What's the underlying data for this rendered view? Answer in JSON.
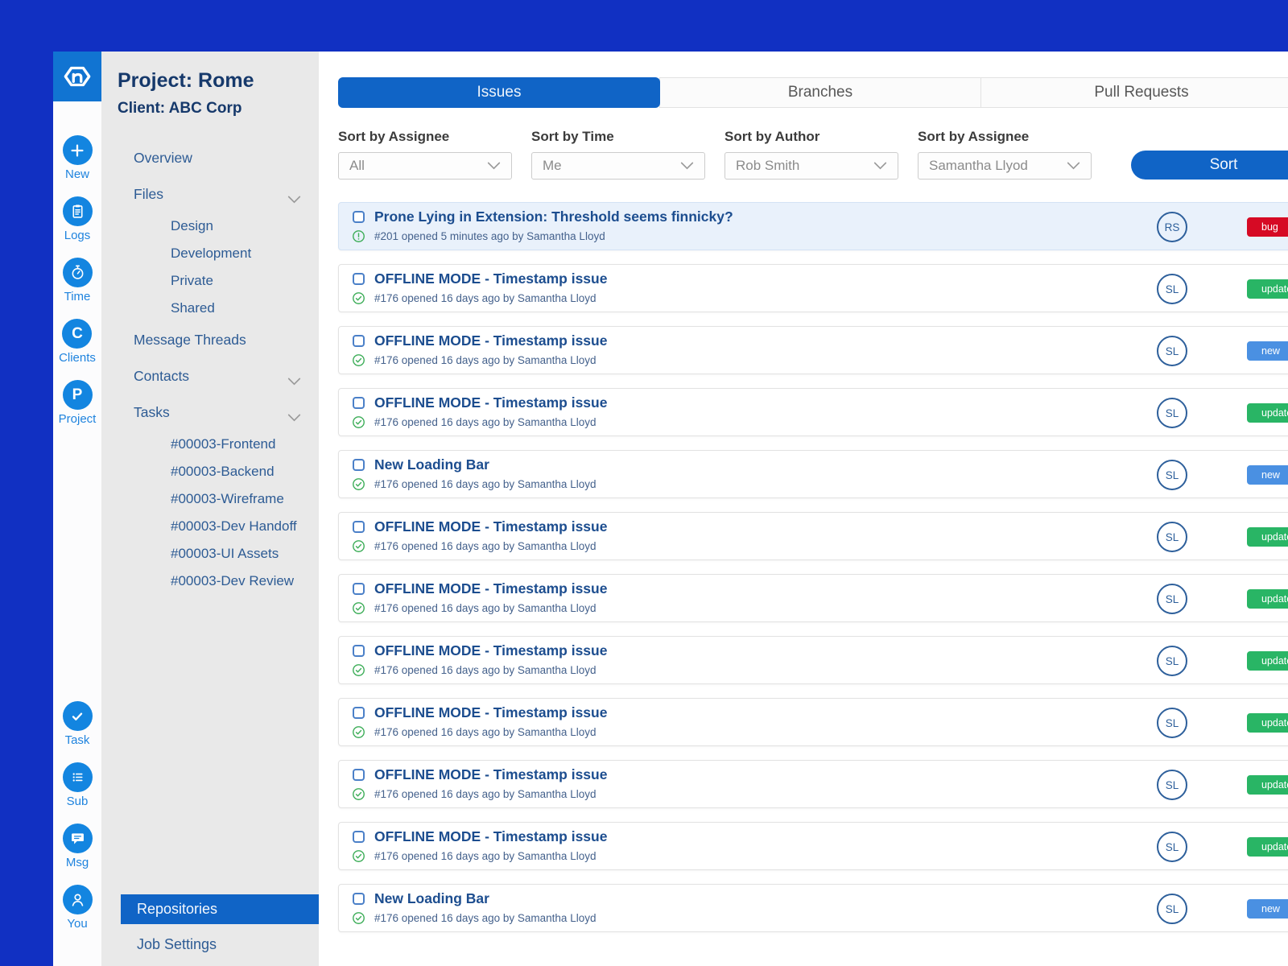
{
  "colors": {
    "frame_blue": "#1130c2",
    "logo_blue": "#1174d2",
    "icon_blue": "#1385e0",
    "primary_blue": "#1064c6",
    "sidebar_bg": "#e9e9e9",
    "badge_red": "#d60a24",
    "badge_green": "#29b565",
    "badge_blue": "#4a90e2",
    "status_green": "#3fae5a"
  },
  "rail": {
    "groups": [
      [
        {
          "icon": "plus-icon",
          "label": "New"
        },
        {
          "icon": "clipboard-icon",
          "label": "Logs"
        },
        {
          "icon": "stopwatch-icon",
          "label": "Time"
        },
        {
          "icon": "letter-c-icon",
          "glyph": "C",
          "label": "Clients"
        },
        {
          "icon": "letter-p-icon",
          "glyph": "P",
          "label": "Project"
        }
      ],
      [
        {
          "icon": "check-icon",
          "label": "Task"
        },
        {
          "icon": "list-icon",
          "label": "Sub"
        },
        {
          "icon": "chat-icon",
          "label": "Msg"
        },
        {
          "icon": "person-icon",
          "label": "You"
        }
      ]
    ]
  },
  "sidebar": {
    "project_title": "Project: Rome",
    "client": "Client: ABC Corp",
    "items": [
      {
        "label": "Overview",
        "level": 0
      },
      {
        "label": "Files",
        "level": 0,
        "chevron": true
      },
      {
        "label": "Design",
        "level": 1
      },
      {
        "label": "Development",
        "level": 1
      },
      {
        "label": "Private",
        "level": 1
      },
      {
        "label": "Shared",
        "level": 1
      },
      {
        "label": "Message Threads",
        "level": 0
      },
      {
        "label": "Contacts",
        "level": 0,
        "chevron": true
      },
      {
        "label": "Tasks",
        "level": 0,
        "chevron": true
      },
      {
        "label": "#00003-Frontend",
        "level": 1
      },
      {
        "label": "#00003-Backend",
        "level": 1
      },
      {
        "label": "#00003-Wireframe",
        "level": 1
      },
      {
        "label": "#00003-Dev Handoff",
        "level": 1
      },
      {
        "label": "#00003-UI Assets",
        "level": 1
      },
      {
        "label": "#00003-Dev Review",
        "level": 1
      }
    ],
    "bottom_items": [
      {
        "label": "Repositories",
        "active": true
      },
      {
        "label": "Job Settings",
        "active": false
      }
    ]
  },
  "tabs": [
    {
      "label": "Issues",
      "active": true
    },
    {
      "label": "Branches",
      "active": false
    },
    {
      "label": "Pull Requests",
      "active": false
    }
  ],
  "filters": [
    {
      "label": "Sort by Assignee",
      "value": "All"
    },
    {
      "label": "Sort by Time",
      "value": "Me"
    },
    {
      "label": "Sort by Author",
      "value": "Rob Smith"
    },
    {
      "label": "Sort by Assignee",
      "value": "Samantha Llyod"
    }
  ],
  "sort_button_label": "Sort",
  "issues": [
    {
      "title": "Prone Lying in Extension: Threshold seems finnicky?",
      "meta": "#201 opened 5 minutes ago by Samantha Lloyd",
      "avatar": "RS",
      "status": "alert",
      "badge": {
        "label": "bug",
        "type": "bug"
      },
      "highlighted": true
    },
    {
      "title": "OFFLINE MODE - Timestamp issue",
      "meta": "#176 opened 16 days ago by Samantha Lloyd",
      "avatar": "SL",
      "status": "check",
      "badge": {
        "label": "updated",
        "type": "updated"
      },
      "highlighted": false
    },
    {
      "title": "OFFLINE MODE - Timestamp issue",
      "meta": "#176 opened 16 days ago by Samantha Lloyd",
      "avatar": "SL",
      "status": "check",
      "badge": {
        "label": "new",
        "type": "new"
      },
      "highlighted": false
    },
    {
      "title": "OFFLINE MODE - Timestamp issue",
      "meta": "#176 opened 16 days ago by Samantha Lloyd",
      "avatar": "SL",
      "status": "check",
      "badge": {
        "label": "updated",
        "type": "updated"
      },
      "highlighted": false
    },
    {
      "title": "New Loading Bar",
      "meta": "#176 opened 16 days ago by Samantha Lloyd",
      "avatar": "SL",
      "status": "check",
      "badge": {
        "label": "new",
        "type": "new"
      },
      "highlighted": false
    },
    {
      "title": "OFFLINE MODE - Timestamp issue",
      "meta": "#176 opened 16 days ago by Samantha Lloyd",
      "avatar": "SL",
      "status": "check",
      "badge": {
        "label": "updated",
        "type": "updated"
      },
      "highlighted": false
    },
    {
      "title": "OFFLINE MODE - Timestamp issue",
      "meta": "#176 opened 16 days ago by Samantha Lloyd",
      "avatar": "SL",
      "status": "check",
      "badge": {
        "label": "updated",
        "type": "updated"
      },
      "highlighted": false
    },
    {
      "title": "OFFLINE MODE - Timestamp issue",
      "meta": "#176 opened 16 days ago by Samantha Lloyd",
      "avatar": "SL",
      "status": "check",
      "badge": {
        "label": "updated",
        "type": "updated"
      },
      "highlighted": false
    },
    {
      "title": "OFFLINE MODE - Timestamp issue",
      "meta": "#176 opened 16 days ago by Samantha Lloyd",
      "avatar": "SL",
      "status": "check",
      "badge": {
        "label": "updated",
        "type": "updated"
      },
      "highlighted": false
    },
    {
      "title": "OFFLINE MODE - Timestamp issue",
      "meta": "#176 opened 16 days ago by Samantha Lloyd",
      "avatar": "SL",
      "status": "check",
      "badge": {
        "label": "updated",
        "type": "updated"
      },
      "highlighted": false
    },
    {
      "title": "OFFLINE MODE - Timestamp issue",
      "meta": "#176 opened 16 days ago by Samantha Lloyd",
      "avatar": "SL",
      "status": "check",
      "badge": {
        "label": "updated",
        "type": "updated"
      },
      "highlighted": false
    },
    {
      "title": "New Loading Bar",
      "meta": "#176 opened 16 days ago by Samantha Lloyd",
      "avatar": "SL",
      "status": "check",
      "badge": {
        "label": "new",
        "type": "new"
      },
      "highlighted": false
    }
  ]
}
